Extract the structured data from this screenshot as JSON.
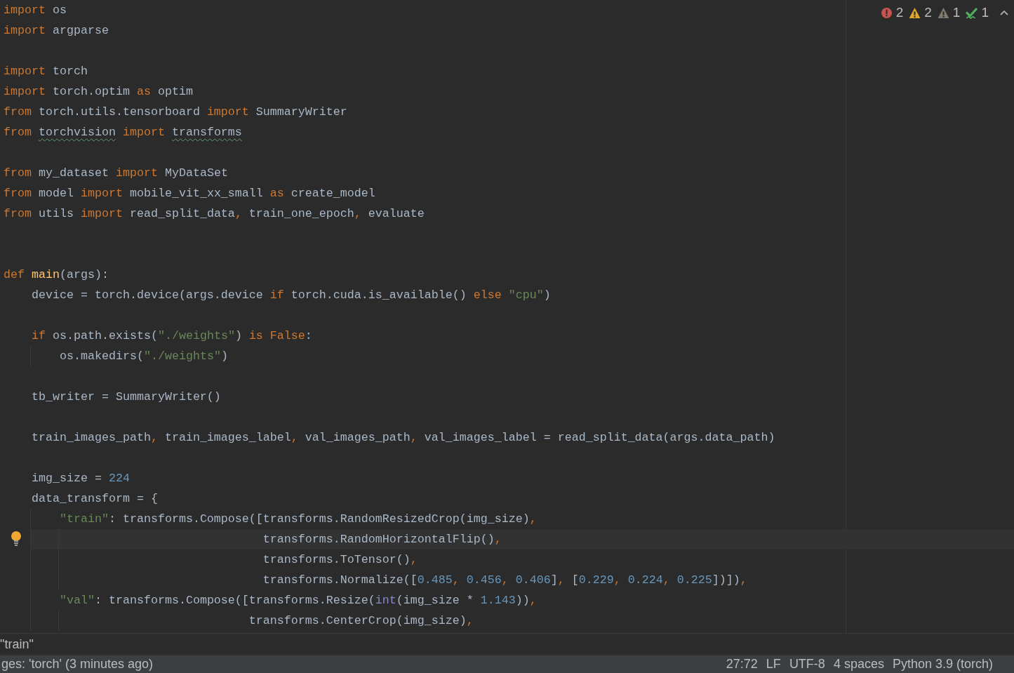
{
  "inspections": [
    {
      "kind": "error",
      "count": "2"
    },
    {
      "kind": "warning",
      "count": "2"
    },
    {
      "kind": "weak_warning",
      "count": "1"
    },
    {
      "kind": "typo",
      "count": "1"
    }
  ],
  "lines": [
    {
      "kind": "code",
      "tokens": [
        {
          "kind": "keyword",
          "text": "import"
        },
        {
          "kind": "plain",
          "text": " os"
        }
      ]
    },
    {
      "kind": "code",
      "tokens": [
        {
          "kind": "keyword",
          "text": "import"
        },
        {
          "kind": "plain",
          "text": " argparse"
        }
      ]
    },
    {
      "kind": "blank"
    },
    {
      "kind": "code",
      "tokens": [
        {
          "kind": "keyword",
          "text": "import"
        },
        {
          "kind": "plain",
          "text": " torch"
        }
      ]
    },
    {
      "kind": "code",
      "tokens": [
        {
          "kind": "keyword",
          "text": "import"
        },
        {
          "kind": "plain",
          "text": " torch.optim "
        },
        {
          "kind": "keyword",
          "text": "as"
        },
        {
          "kind": "plain",
          "text": " optim"
        }
      ]
    },
    {
      "kind": "code",
      "tokens": [
        {
          "kind": "keyword",
          "text": "from"
        },
        {
          "kind": "plain",
          "text": " torch.utils.tensorboard "
        },
        {
          "kind": "keyword",
          "text": "import"
        },
        {
          "kind": "plain",
          "text": " SummaryWriter"
        }
      ]
    },
    {
      "kind": "code",
      "tokens": [
        {
          "kind": "keyword",
          "text": "from "
        },
        {
          "kind": "typo",
          "text": "torchvision"
        },
        {
          "kind": "keyword",
          "text": " import "
        },
        {
          "kind": "typo",
          "text": "transforms"
        }
      ]
    },
    {
      "kind": "blank"
    },
    {
      "kind": "code",
      "tokens": [
        {
          "kind": "keyword",
          "text": "from"
        },
        {
          "kind": "plain",
          "text": " my_dataset "
        },
        {
          "kind": "keyword",
          "text": "import"
        },
        {
          "kind": "plain",
          "text": " MyDataSet"
        }
      ]
    },
    {
      "kind": "code",
      "tokens": [
        {
          "kind": "keyword",
          "text": "from"
        },
        {
          "kind": "plain",
          "text": " model "
        },
        {
          "kind": "keyword",
          "text": "import"
        },
        {
          "kind": "plain",
          "text": " mobile_vit_xx_small "
        },
        {
          "kind": "keyword",
          "text": "as"
        },
        {
          "kind": "plain",
          "text": " create_model"
        }
      ]
    },
    {
      "kind": "code",
      "tokens": [
        {
          "kind": "keyword",
          "text": "from"
        },
        {
          "kind": "plain",
          "text": " utils "
        },
        {
          "kind": "keyword",
          "text": "import"
        },
        {
          "kind": "plain",
          "text": " read_split_data"
        },
        {
          "kind": "keyword",
          "text": ","
        },
        {
          "kind": "plain",
          "text": " train_one_epoch"
        },
        {
          "kind": "keyword",
          "text": ","
        },
        {
          "kind": "plain",
          "text": " evaluate"
        }
      ]
    },
    {
      "kind": "blank"
    },
    {
      "kind": "blank"
    },
    {
      "kind": "code",
      "tokens": [
        {
          "kind": "keyword",
          "text": "def "
        },
        {
          "kind": "function",
          "text": "main"
        },
        {
          "kind": "plain",
          "text": "(args):"
        }
      ]
    },
    {
      "kind": "code",
      "tokens": [
        {
          "kind": "plain",
          "text": "    device = torch.device(args.device "
        },
        {
          "kind": "keyword",
          "text": "if"
        },
        {
          "kind": "plain",
          "text": " torch.cuda.is_available() "
        },
        {
          "kind": "keyword",
          "text": "else"
        },
        {
          "kind": "string",
          "text": " \"cpu\""
        },
        {
          "kind": "plain",
          "text": ")"
        }
      ]
    },
    {
      "kind": "blank"
    },
    {
      "kind": "code",
      "tokens": [
        {
          "kind": "keyword",
          "text": "    if"
        },
        {
          "kind": "plain",
          "text": " os.path.exists("
        },
        {
          "kind": "string",
          "text": "\"./weights\""
        },
        {
          "kind": "plain",
          "text": ") "
        },
        {
          "kind": "keyword",
          "text": "is False"
        },
        {
          "kind": "plain",
          "text": ":"
        }
      ]
    },
    {
      "kind": "code",
      "tokens": [
        {
          "kind": "plain",
          "text": "        os.makedirs("
        },
        {
          "kind": "string",
          "text": "\"./weights\""
        },
        {
          "kind": "plain",
          "text": ")"
        }
      ]
    },
    {
      "kind": "blank"
    },
    {
      "kind": "code",
      "tokens": [
        {
          "kind": "plain",
          "text": "    tb_writer = SummaryWriter()"
        }
      ]
    },
    {
      "kind": "blank"
    },
    {
      "kind": "code",
      "tokens": [
        {
          "kind": "plain",
          "text": "    train_images_path"
        },
        {
          "kind": "keyword",
          "text": ","
        },
        {
          "kind": "plain",
          "text": " train_images_label"
        },
        {
          "kind": "keyword",
          "text": ","
        },
        {
          "kind": "plain",
          "text": " val_images_path"
        },
        {
          "kind": "keyword",
          "text": ","
        },
        {
          "kind": "plain",
          "text": " val_images_label = read_split_data(args.data_path)"
        }
      ]
    },
    {
      "kind": "blank"
    },
    {
      "kind": "code",
      "tokens": [
        {
          "kind": "plain",
          "text": "    img_size = "
        },
        {
          "kind": "number",
          "text": "224"
        }
      ]
    },
    {
      "kind": "code",
      "tokens": [
        {
          "kind": "plain",
          "text": "    data_transform = {"
        }
      ]
    },
    {
      "kind": "code",
      "tokens": [
        {
          "kind": "string",
          "text": "        \"train\""
        },
        {
          "kind": "plain",
          "text": ": transforms.Compose([transforms.RandomResizedCrop(img_size)"
        },
        {
          "kind": "keyword",
          "text": ","
        }
      ]
    },
    {
      "kind": "code",
      "current": true,
      "tokens": [
        {
          "kind": "plain",
          "text": "                                     transforms.RandomHorizontalFlip()"
        },
        {
          "kind": "keyword",
          "text": ","
        }
      ]
    },
    {
      "kind": "code",
      "tokens": [
        {
          "kind": "plain",
          "text": "                                     transforms.ToTensor()"
        },
        {
          "kind": "keyword",
          "text": ","
        }
      ]
    },
    {
      "kind": "code",
      "tokens": [
        {
          "kind": "plain",
          "text": "                                     transforms.Normalize(["
        },
        {
          "kind": "number",
          "text": "0.485"
        },
        {
          "kind": "keyword",
          "text": ","
        },
        {
          "kind": "number",
          "text": " 0.456"
        },
        {
          "kind": "keyword",
          "text": ","
        },
        {
          "kind": "number",
          "text": " 0.406"
        },
        {
          "kind": "plain",
          "text": "]"
        },
        {
          "kind": "keyword",
          "text": ","
        },
        {
          "kind": "plain",
          "text": " ["
        },
        {
          "kind": "number",
          "text": "0.229"
        },
        {
          "kind": "keyword",
          "text": ","
        },
        {
          "kind": "number",
          "text": " 0.224"
        },
        {
          "kind": "keyword",
          "text": ","
        },
        {
          "kind": "number",
          "text": " 0.225"
        },
        {
          "kind": "plain",
          "text": "])])"
        },
        {
          "kind": "keyword",
          "text": ","
        }
      ]
    },
    {
      "kind": "code",
      "tokens": [
        {
          "kind": "string",
          "text": "        \"val\""
        },
        {
          "kind": "plain",
          "text": ": transforms.Compose([transforms.Resize("
        },
        {
          "kind": "builtin",
          "text": "int"
        },
        {
          "kind": "plain",
          "text": "(img_size * "
        },
        {
          "kind": "number",
          "text": "1.143"
        },
        {
          "kind": "plain",
          "text": "))"
        },
        {
          "kind": "keyword",
          "text": ","
        }
      ]
    },
    {
      "kind": "code",
      "tokens": [
        {
          "kind": "plain",
          "text": "                                   transforms.CenterCrop(img_size)"
        },
        {
          "kind": "keyword",
          "text": ","
        }
      ]
    }
  ],
  "breadcrumb": "\"train\"",
  "status_bar": {
    "message": "ges: 'torch' (3 minutes ago)",
    "items": [
      "27:72",
      "LF",
      "UTF-8",
      "4 spaces",
      "Python 3.9 (torch)"
    ]
  }
}
